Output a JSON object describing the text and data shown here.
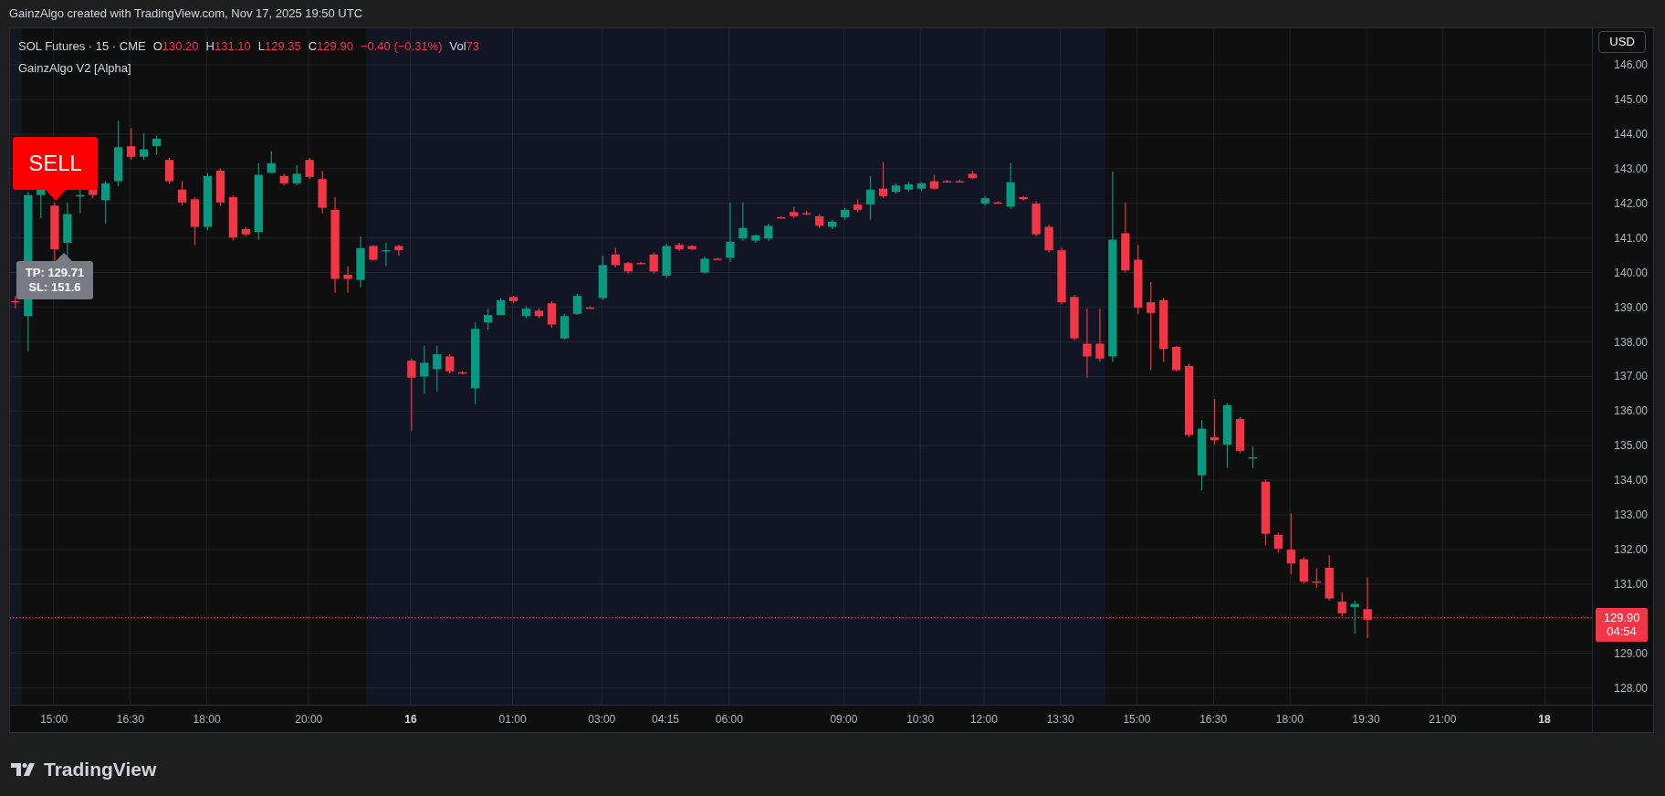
{
  "header": {
    "attribution": "GainzAlgo created with TradingView.com, Nov 17, 2025 19:50 UTC"
  },
  "legend": {
    "symbol": "SOL Futures · 15 · CME",
    "values": [
      {
        "label": "O",
        "value": "130.20"
      },
      {
        "label": "H",
        "value": "131.10"
      },
      {
        "label": "L",
        "value": "129.35"
      },
      {
        "label": "C",
        "value": "129.90"
      }
    ],
    "change": "−0.40 (−0.31%)",
    "volume": {
      "label": "Vol",
      "value": "73"
    },
    "indicator": "GainzAlgo V2 [Alpha]"
  },
  "signal": {
    "label": "SELL",
    "targets": [
      "TP: 129.71",
      "SL: 151.6"
    ]
  },
  "price_axis": {
    "currency": "USD",
    "labels": [
      "146.00",
      "145.00",
      "144.00",
      "143.00",
      "142.00",
      "141.00",
      "140.00",
      "139.00",
      "138.00",
      "137.00",
      "136.00",
      "135.00",
      "134.00",
      "133.00",
      "132.00",
      "131.00",
      "129.00",
      "128.00"
    ],
    "last_price": "129.90",
    "countdown": "04:54"
  },
  "time_axis": {
    "labels": [
      {
        "text": "15:00",
        "kind": "time"
      },
      {
        "text": "16:30",
        "kind": "time"
      },
      {
        "text": "18:00",
        "kind": "time"
      },
      {
        "text": "20:00",
        "kind": "time"
      },
      {
        "text": "16",
        "kind": "day"
      },
      {
        "text": "01:00",
        "kind": "time"
      },
      {
        "text": "03:00",
        "kind": "time"
      },
      {
        "text": "04:15",
        "kind": "time"
      },
      {
        "text": "06:00",
        "kind": "time"
      },
      {
        "text": "09:00",
        "kind": "time"
      },
      {
        "text": "10:30",
        "kind": "time"
      },
      {
        "text": "12:00",
        "kind": "time"
      },
      {
        "text": "13:30",
        "kind": "time"
      },
      {
        "text": "15:00",
        "kind": "time"
      },
      {
        "text": "16:30",
        "kind": "time"
      },
      {
        "text": "18:00",
        "kind": "time"
      },
      {
        "text": "19:30",
        "kind": "time"
      },
      {
        "text": "21:00",
        "kind": "time"
      },
      {
        "text": "18",
        "kind": "day"
      }
    ]
  },
  "footer": {
    "brand": "TradingView"
  }
}
